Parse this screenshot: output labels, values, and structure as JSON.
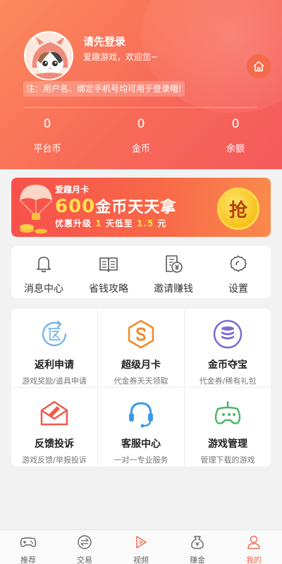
{
  "header": {
    "login_title": "请先登录",
    "welcome": "爱趣游戏，欢迎您~",
    "notice": "注：用户名、绑定手机号均可用于登录哦!",
    "stats": [
      {
        "value": "0",
        "label": "平台币"
      },
      {
        "value": "0",
        "label": "金币"
      },
      {
        "value": "0",
        "label": "余额"
      }
    ]
  },
  "banner": {
    "small_title": "爱趣月卡",
    "big_highlight": "600",
    "big_text": "金币天天拿",
    "sub_prefix": "优惠升级",
    "sub_num1": "1",
    "sub_mid": "天低至",
    "sub_num2": "1.5",
    "sub_suffix": "元",
    "button": "抢"
  },
  "quick_menu": [
    {
      "label": "消息中心",
      "icon": "bell-icon"
    },
    {
      "label": "省钱攻略",
      "icon": "book-icon"
    },
    {
      "label": "邀请赚钱",
      "icon": "invite-money-icon"
    },
    {
      "label": "设置",
      "icon": "gear-icon"
    }
  ],
  "services": [
    {
      "title": "返利申请",
      "desc": "游戏奖励/道具申请",
      "icon": "rebate-icon"
    },
    {
      "title": "超级月卡",
      "desc": "代金券天天领取",
      "icon": "monthly-card-icon"
    },
    {
      "title": "金币夺宝",
      "desc": "代金券/稀有礼包",
      "icon": "coin-treasure-icon"
    },
    {
      "title": "反馈投诉",
      "desc": "游戏反馈/举报投诉",
      "icon": "feedback-icon"
    },
    {
      "title": "客服中心",
      "desc": "一对一专业服务",
      "icon": "headset-icon"
    },
    {
      "title": "游戏管理",
      "desc": "管理下载的游戏",
      "icon": "gamepad-icon"
    }
  ],
  "tabs": [
    {
      "label": "推荐",
      "icon": "gamepad-tab-icon"
    },
    {
      "label": "交易",
      "icon": "trade-icon"
    },
    {
      "label": "视频",
      "icon": "video-icon"
    },
    {
      "label": "赚金",
      "icon": "money-bag-icon"
    },
    {
      "label": "我的",
      "icon": "user-icon",
      "active": true
    }
  ],
  "colors": {
    "accent": "#f36a55",
    "header_start": "#fb8a5c",
    "header_end": "#f45a5c",
    "gold": "#ffe14a"
  }
}
